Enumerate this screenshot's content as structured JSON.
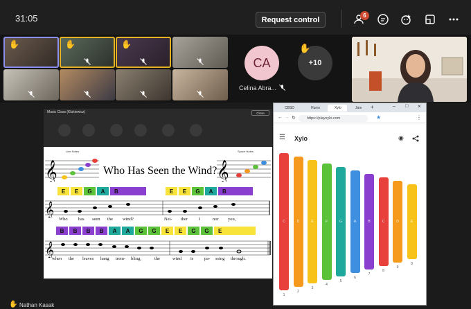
{
  "topbar": {
    "timer": "31:05",
    "request_control_label": "Request control",
    "participants_badge": "6",
    "icons": [
      "participants-icon",
      "chat-icon",
      "reactions-icon",
      "share-icon",
      "more-icon"
    ]
  },
  "gallery": {
    "celina_initials": "CA",
    "celina_name": "Celina Abra...",
    "overflow_count": "+10"
  },
  "classroom": {
    "window_title": "Music Class (Klukiewicz)",
    "close_label": "Close",
    "line_notes_label": "Line Notes",
    "space_notes_label": "Space Notes",
    "song_title": "Who Has Seen the Wind?",
    "row1_notes": [
      "E",
      "E",
      "G",
      "A",
      "B"
    ],
    "row1_notes_b": [
      "E",
      "E",
      "G",
      "A",
      "B"
    ],
    "row2_notes": [
      "B",
      "B",
      "B",
      "B",
      "A",
      "A",
      "G",
      "G",
      "E",
      "E",
      "G",
      "G",
      "E"
    ],
    "lyrics1": [
      "Who",
      "has",
      "seen",
      "the",
      "wind?",
      "Nei-",
      "ther",
      "I",
      "nor",
      "you,"
    ],
    "lyrics2": [
      "when",
      "the",
      "leaves",
      "hang",
      "trem-",
      "bling,",
      "the",
      "wind",
      "is",
      "pa-",
      "ssing",
      "through."
    ]
  },
  "browser": {
    "tab_labels": [
      "CBSD",
      "Hums",
      "Xylo",
      "Jam"
    ],
    "url": "https://playxylo.com",
    "app_title": "Xylo",
    "bar_labels": [
      "C",
      "D",
      "E",
      "F",
      "G",
      "A",
      "B",
      "C",
      "D",
      "E"
    ],
    "bar_numbers": [
      "1",
      "2",
      "3",
      "4",
      "5",
      "6",
      "7",
      "8",
      "9",
      "0"
    ],
    "bar_colors": [
      "#e8413c",
      "#f59a1c",
      "#f7c21a",
      "#5cc23a",
      "#1fa89c",
      "#3f8fe0",
      "#8a3fcf",
      "#e8413c",
      "#f59a1c",
      "#f7c21a"
    ]
  },
  "footer": {
    "presenter_name": "Nathan Kasak"
  }
}
